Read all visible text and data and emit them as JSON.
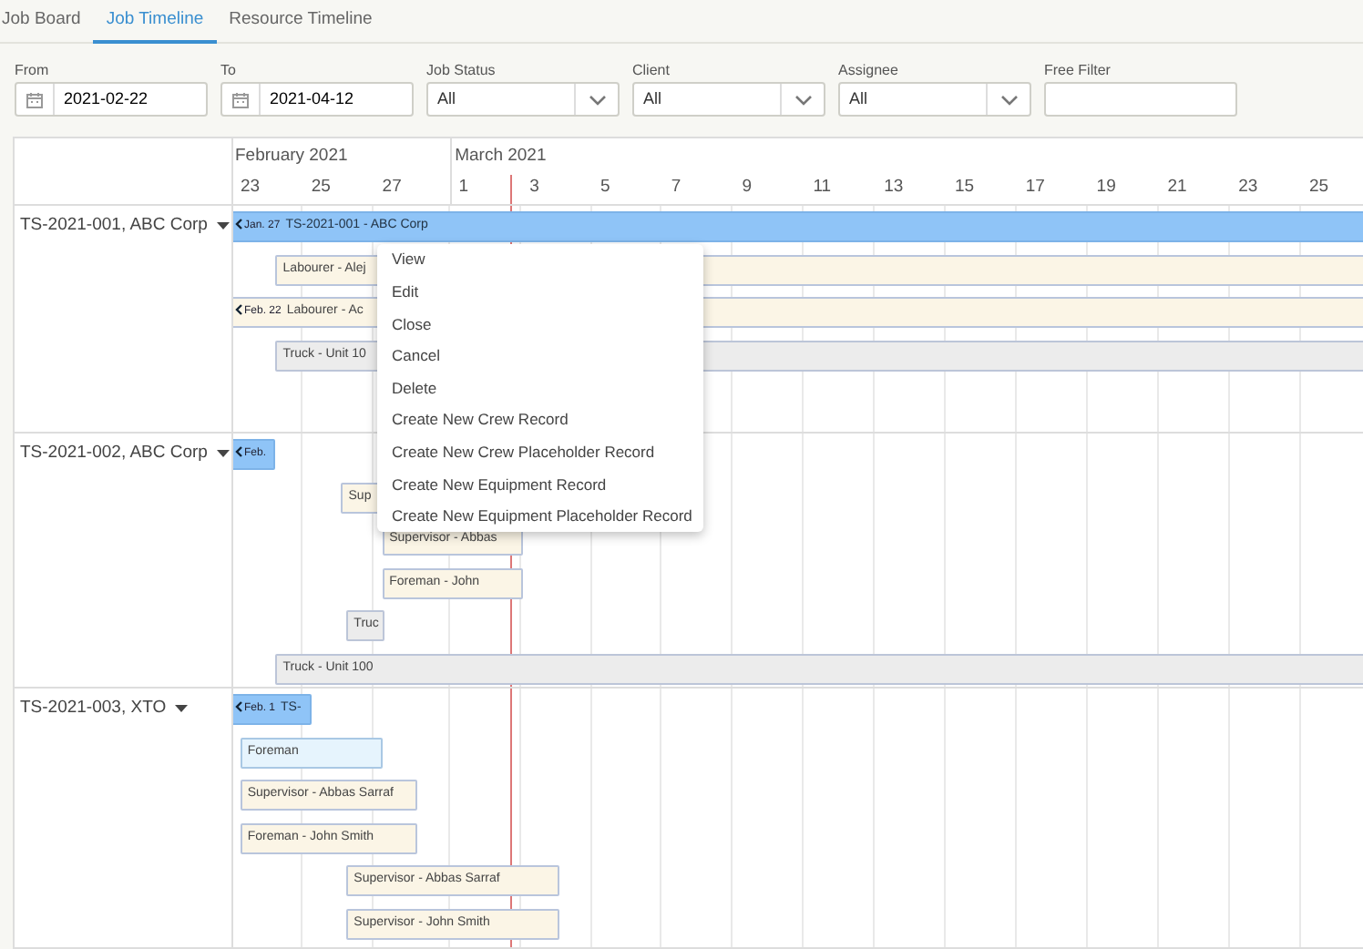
{
  "tabs": [
    {
      "label": "Job Board",
      "selected": false
    },
    {
      "label": "Job Timeline",
      "selected": true
    },
    {
      "label": "Resource Timeline",
      "selected": false
    }
  ],
  "filters": [
    {
      "label": "From",
      "kind": "date",
      "value": "2021-02-22"
    },
    {
      "label": "To",
      "kind": "date",
      "value": "2021-04-12"
    },
    {
      "label": "Job Status",
      "kind": "select",
      "value": "All"
    },
    {
      "label": "Client",
      "kind": "select",
      "value": "All"
    },
    {
      "label": "Assignee",
      "kind": "select",
      "value": "All"
    },
    {
      "label": "Free Filter",
      "kind": "text"
    }
  ],
  "timeline": {
    "months": [
      "February 2021",
      "March 2021"
    ],
    "days": [
      "23",
      "25",
      "27",
      "1",
      "3",
      "5",
      "7",
      "9",
      "11",
      "13",
      "15",
      "17",
      "19",
      "21",
      "23",
      "25"
    ],
    "groups": [
      {
        "label": "TS-2021-001, ABC Corp",
        "events": [
          {
            "kind": "job",
            "label": "TS-2021-001 - ABC Corp",
            "from": "Jan. 27"
          },
          {
            "kind": "crew",
            "label": "Labourer - Alej"
          },
          {
            "kind": "crew",
            "label": "Labourer - Ac",
            "from": "Feb. 22"
          },
          {
            "kind": "equipment",
            "label": "Truck - Unit 10"
          }
        ]
      },
      {
        "label": "TS-2021-002, ABC Corp",
        "events": [
          {
            "kind": "job",
            "from": "Feb."
          },
          {
            "kind": "crew",
            "label": "Sup"
          },
          {
            "kind": "crew",
            "label": "Supervisor - Abbas"
          },
          {
            "kind": "crew",
            "label": "Foreman - John"
          },
          {
            "kind": "equipment",
            "label": "Truc"
          },
          {
            "kind": "equipment",
            "label": "Truck - Unit 100"
          }
        ]
      },
      {
        "label": "TS-2021-003, XTO",
        "events": [
          {
            "kind": "job",
            "label": "TS-",
            "from": "Feb. 1"
          },
          {
            "kind": "placeholder",
            "label": "Foreman"
          },
          {
            "kind": "crew",
            "label": "Supervisor - Abbas Sarraf"
          },
          {
            "kind": "crew",
            "label": "Foreman - John Smith"
          },
          {
            "kind": "crew",
            "label": "Supervisor - Abbas Sarraf"
          },
          {
            "kind": "crew",
            "label": "Supervisor - John Smith"
          }
        ]
      }
    ]
  },
  "context_menu": [
    "View",
    "Edit",
    "Close",
    "Cancel",
    "Delete",
    "Create New Crew Record",
    "Create New Crew Placeholder Record",
    "Create New Equipment Record",
    "Create New Equipment Placeholder Record"
  ]
}
